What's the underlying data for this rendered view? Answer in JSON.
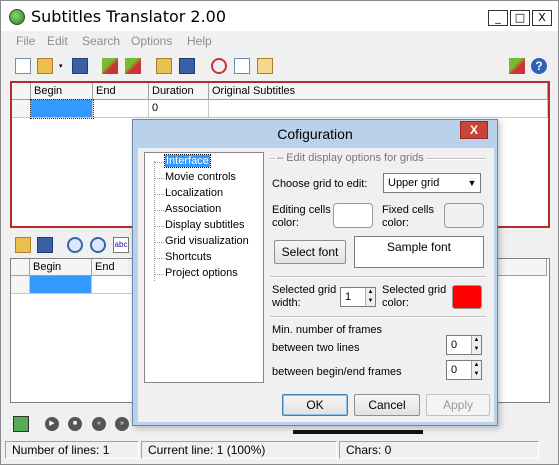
{
  "window": {
    "title": "Subtitles Translator 2.00",
    "minimize": "_",
    "maximize": "□",
    "close": "X"
  },
  "menu": [
    "File",
    "Edit",
    "Search",
    "Options",
    "Help"
  ],
  "grid1": {
    "columns": [
      "Begin",
      "End",
      "Duration",
      "Original Subtitles"
    ],
    "rows": [
      {
        "begin": "",
        "end": "",
        "duration": "0",
        "original": ""
      }
    ]
  },
  "grid2": {
    "columns": [
      "Begin",
      "End"
    ],
    "rows": [
      {
        "begin": "",
        "end": ""
      }
    ]
  },
  "toolbar2_spell": "abc",
  "status": {
    "lines": "Number of lines: 1",
    "current": "Current line: 1 (100%)",
    "chars": "Chars: 0"
  },
  "dialog": {
    "title": "Cofiguration",
    "close": "X",
    "tree": [
      "Interface",
      "Movie controls",
      "Localization",
      "Association",
      "Display subtitles",
      "Grid visualization",
      "Shortcuts",
      "Project options"
    ],
    "selected_tree": "Interface",
    "group_title": "Edit display options for grids",
    "choose_grid_label": "Choose grid to edit:",
    "choose_grid_value": "Upper grid",
    "editing_cells_color_label": "Editing cells color:",
    "fixed_cells_color_label": "Fixed cells color:",
    "select_font": "Select font",
    "sample_font": "Sample font",
    "selected_grid_width_label": "Selected grid width:",
    "selected_grid_width_value": "1",
    "selected_grid_color_label": "Selected grid color:",
    "selected_grid_color": "#ff0000",
    "min_frames_label": "Min. number of frames",
    "between_lines_label": "between two lines",
    "between_lines_value": "0",
    "between_begin_end_label": "between begin/end frames",
    "between_begin_end_value": "0",
    "ok": "OK",
    "cancel": "Cancel",
    "apply": "Apply"
  },
  "colors": {
    "accent_border": "#b32d2d",
    "selection": "#3399ff",
    "dialog_frame": "#b9d1ea"
  }
}
